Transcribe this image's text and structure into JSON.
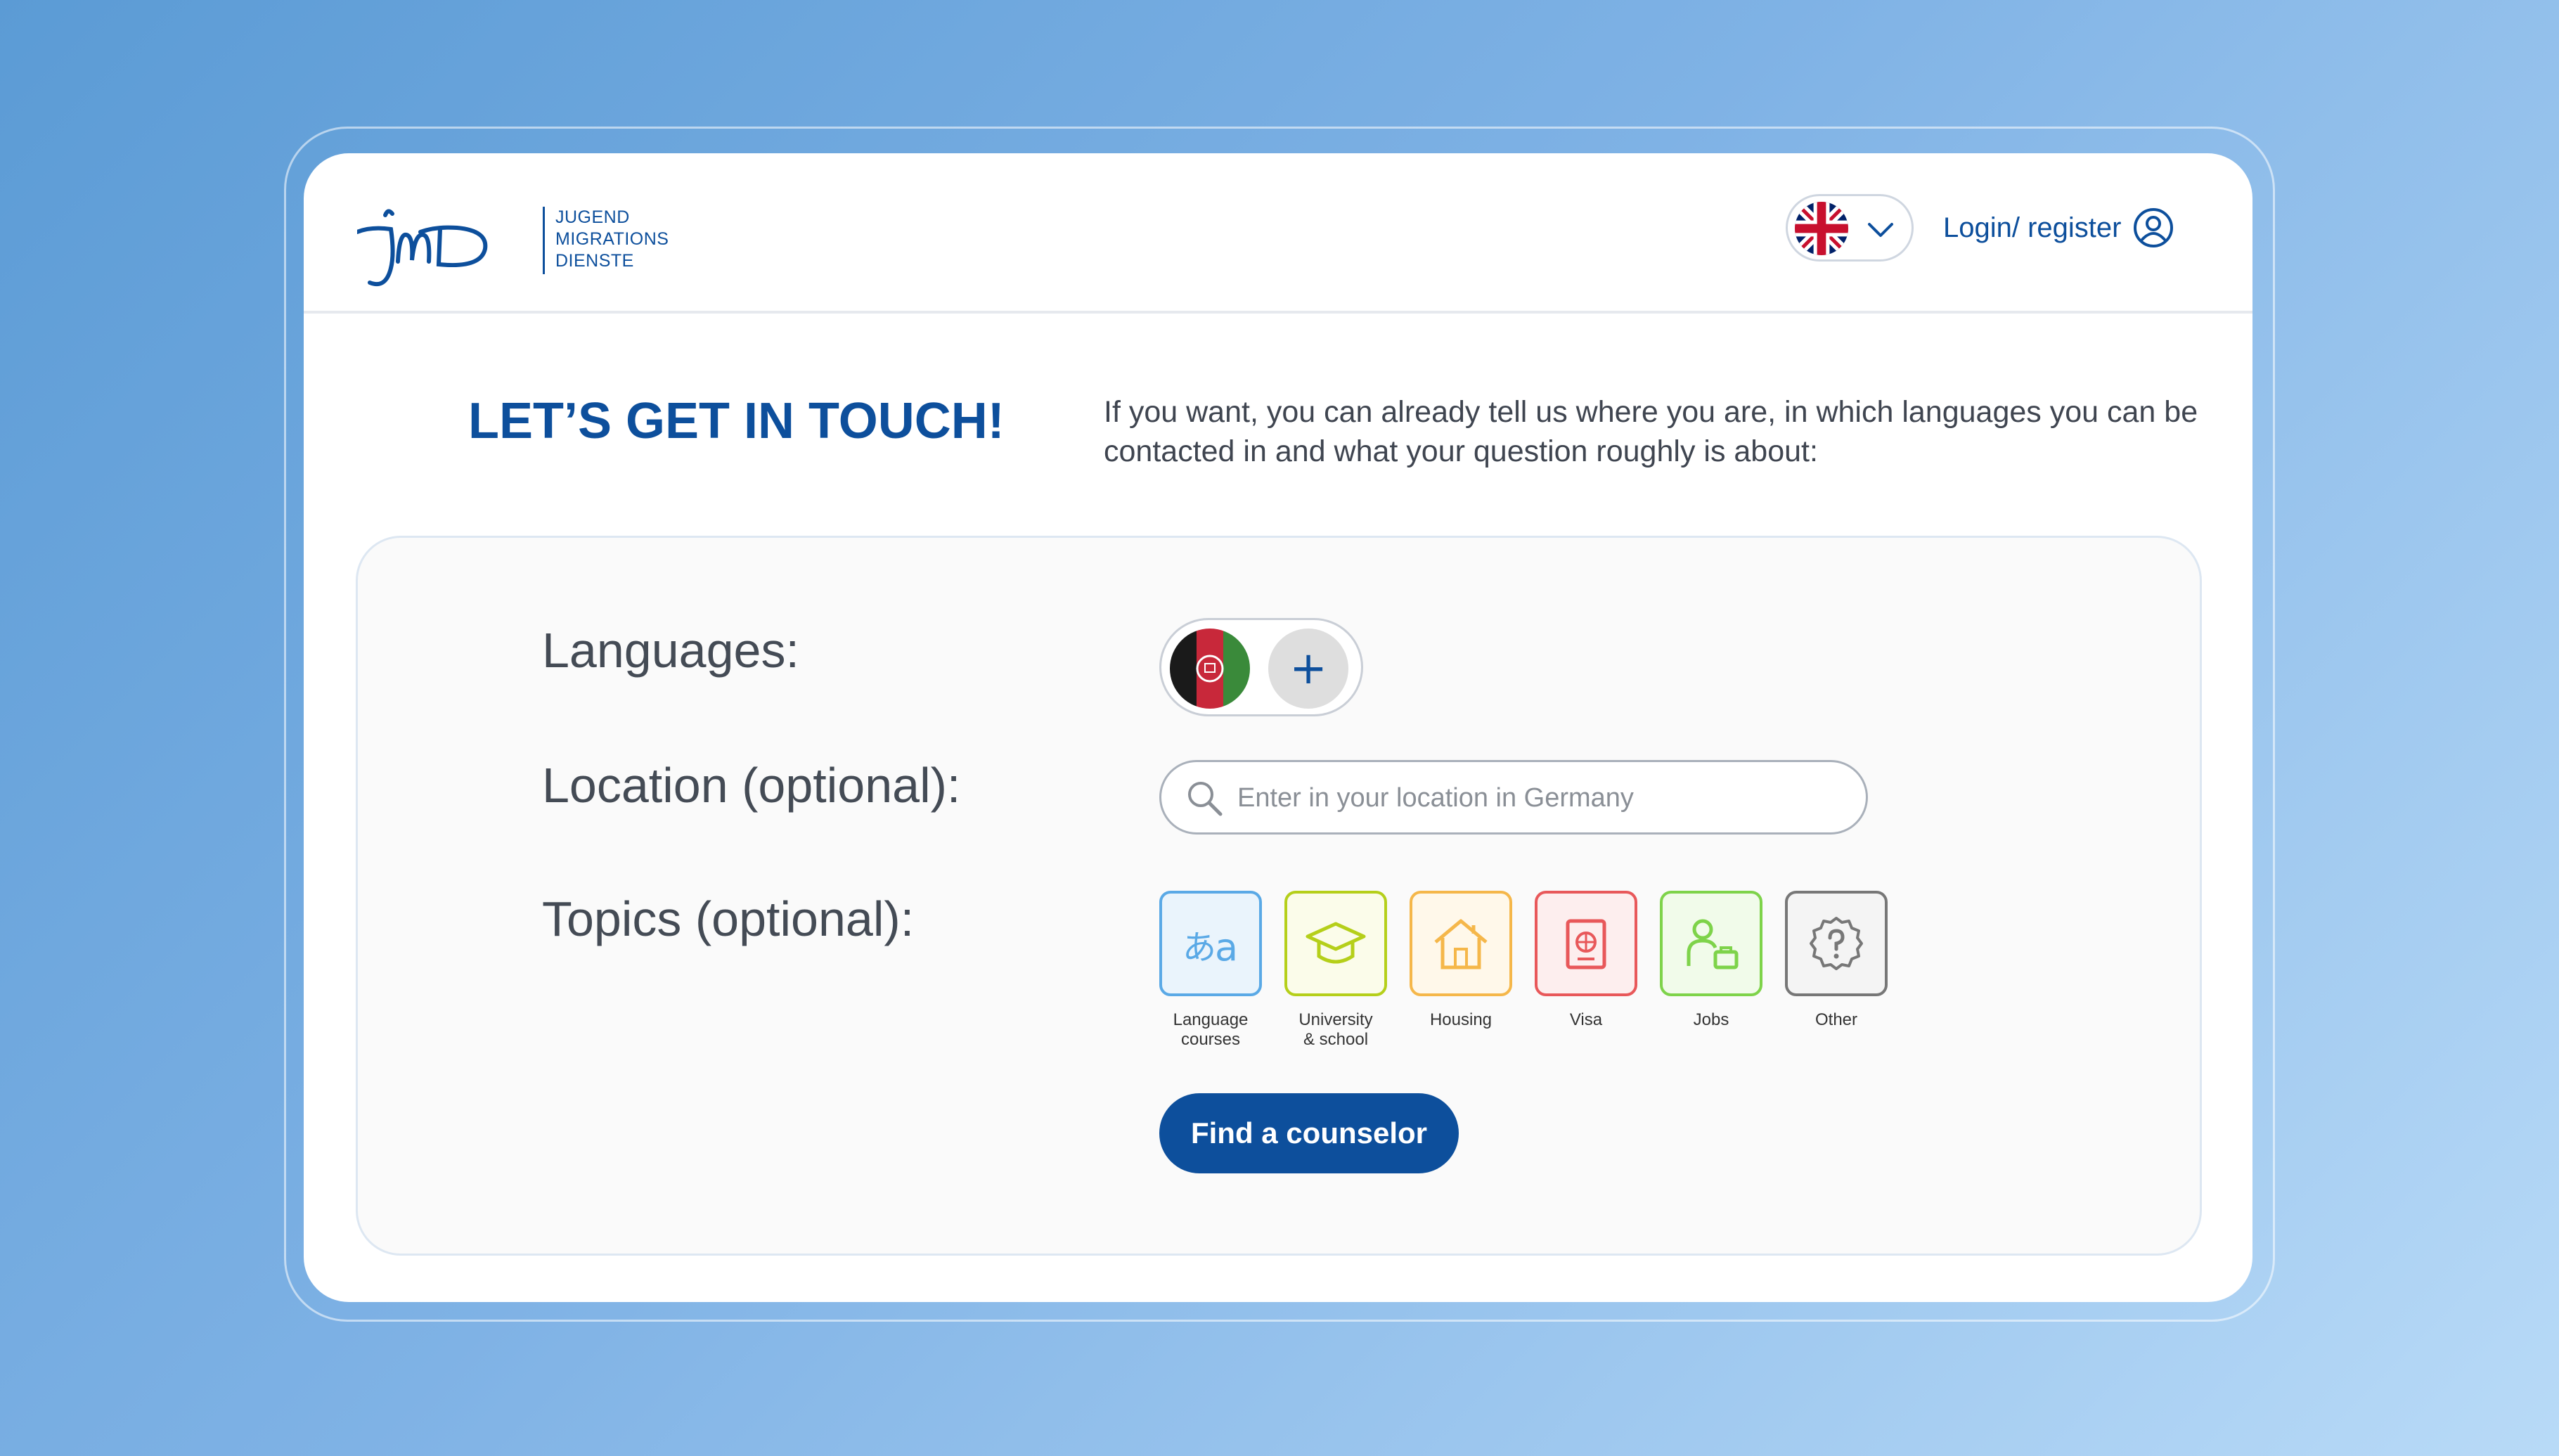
{
  "brand": {
    "logo_lines": [
      "JUGEND",
      "MIGRATIONS",
      "DIENSTE"
    ]
  },
  "header": {
    "language_selected": "English (UK)",
    "login_label": "Login/ register"
  },
  "hero": {
    "title": "LET’S GET IN TOUCH!",
    "intro": "If you want, you can already tell us where you are, in which languages you can be contacted in and what your question roughly is about:"
  },
  "form": {
    "languages_label": "Languages:",
    "selected_language_flag": "afghanistan-flag",
    "add_language_icon": "plus-icon",
    "location_label": "Location (optional):",
    "location_placeholder": "Enter in your location in Germany",
    "location_value": "",
    "topics_label": "Topics (optional):",
    "topics": [
      {
        "label_line1": "Language",
        "label_line2": "courses",
        "icon": "language-icon",
        "color": "#5aa9e6",
        "bg": "#eaf4fc"
      },
      {
        "label_line1": "University",
        "label_line2": "& school",
        "icon": "graduation-cap-icon",
        "color": "#b5cf1a",
        "bg": "#fbfcea"
      },
      {
        "label_line1": "Housing",
        "label_line2": "",
        "icon": "house-icon",
        "color": "#f5b74a",
        "bg": "#fff8ea"
      },
      {
        "label_line1": "Visa",
        "label_line2": "",
        "icon": "passport-icon",
        "color": "#e8585a",
        "bg": "#fdeeee"
      },
      {
        "label_line1": "Jobs",
        "label_line2": "",
        "icon": "jobs-icon",
        "color": "#7ed34a",
        "bg": "#f1fbea"
      },
      {
        "label_line1": "Other",
        "label_line2": "",
        "icon": "question-icon",
        "color": "#777777",
        "bg": "#f4f4f4"
      }
    ],
    "submit_label": "Find a counselor"
  },
  "colors": {
    "primary": "#0d4f9c",
    "text": "#444b55"
  }
}
